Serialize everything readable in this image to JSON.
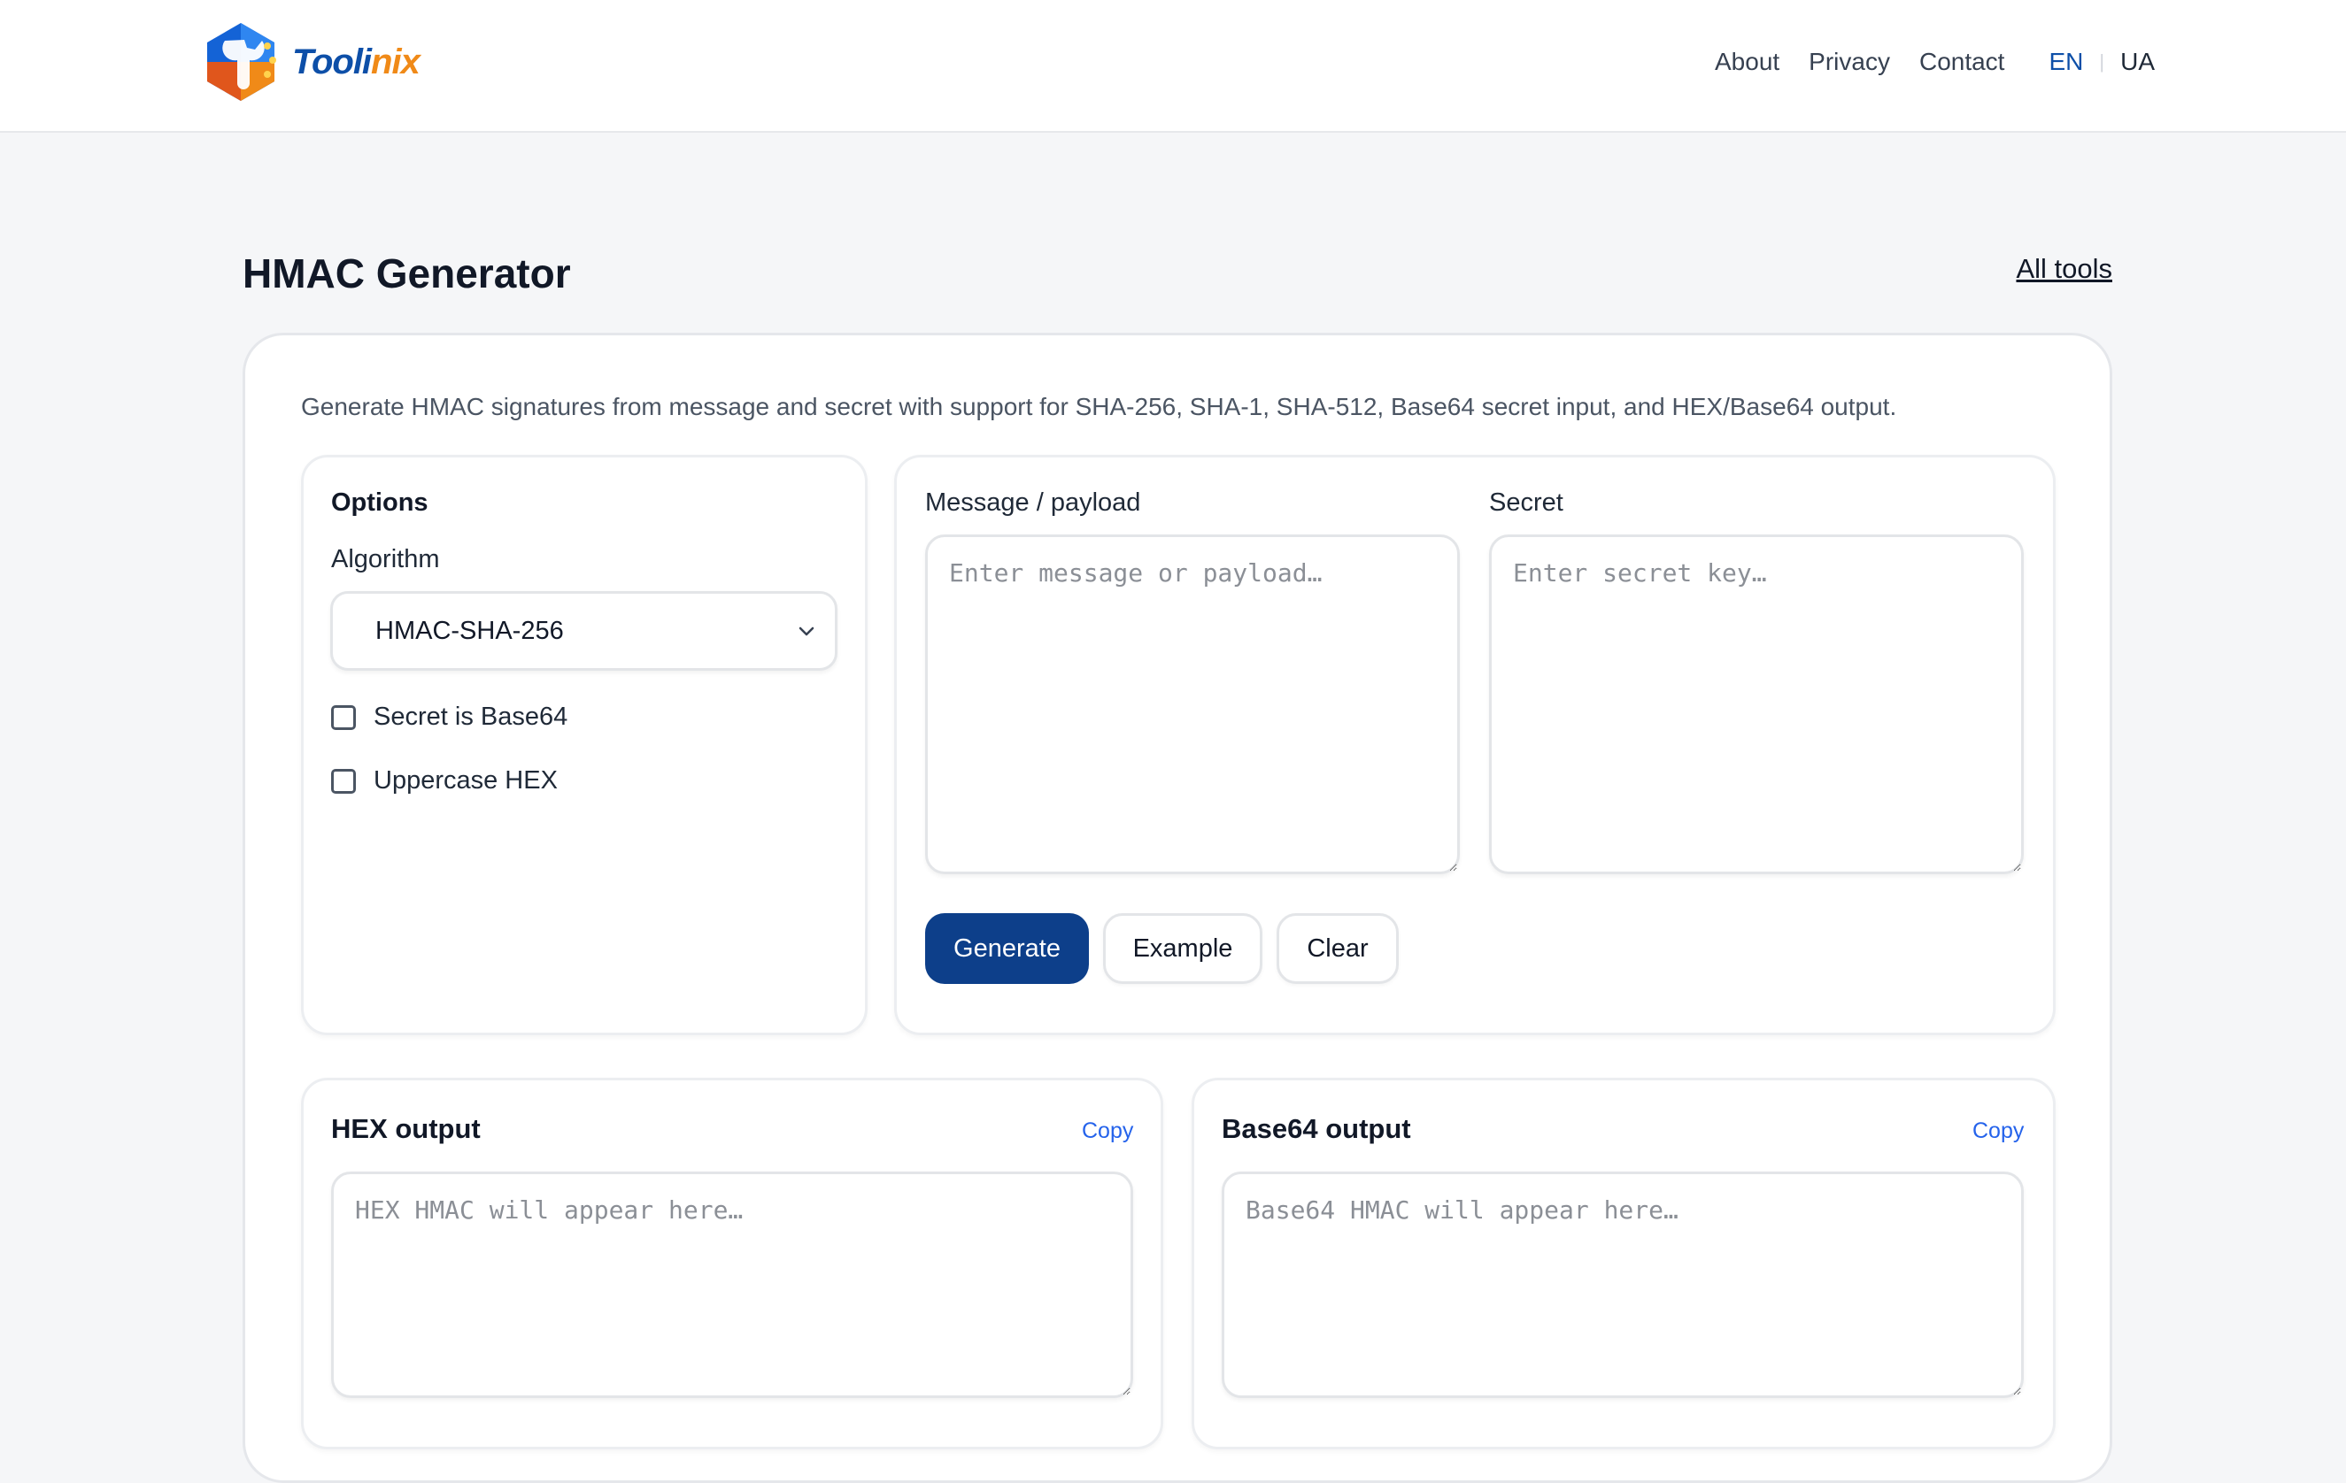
{
  "header": {
    "logo_text_main": "Tooli",
    "logo_text_accent": "nix",
    "nav": [
      "About",
      "Privacy",
      "Contact"
    ],
    "lang_active": "EN",
    "lang_other": "UA"
  },
  "page": {
    "title": "HMAC Generator",
    "all_tools": "All tools",
    "description": "Generate HMAC signatures from message and secret with support for SHA-256, SHA-1, SHA-512, Base64 secret input, and HEX/Base64 output."
  },
  "options": {
    "title": "Options",
    "algorithm_label": "Algorithm",
    "algorithm_value": "HMAC-SHA-256",
    "secret_base64": "Secret is Base64",
    "uppercase_hex": "Uppercase HEX"
  },
  "inputs": {
    "message_label": "Message / payload",
    "message_placeholder": "Enter message or payload…",
    "secret_label": "Secret",
    "secret_placeholder": "Enter secret key…"
  },
  "actions": {
    "generate": "Generate",
    "example": "Example",
    "clear": "Clear"
  },
  "outputs": {
    "hex_title": "HEX output",
    "hex_placeholder": "HEX HMAC will appear here…",
    "base64_title": "Base64 output",
    "base64_placeholder": "Base64 HMAC will appear here…",
    "copy": "Copy"
  }
}
